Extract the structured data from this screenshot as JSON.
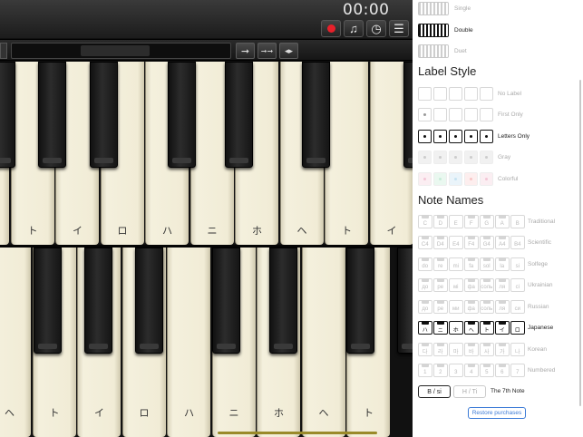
{
  "toolbar": {
    "timer": "00:00",
    "record_icon": "record-icon",
    "music_icon": "music-note-icon",
    "metronome_icon": "metronome-icon",
    "menu_icon": "menu-icon",
    "menu_glyph": "☰",
    "music_glyph": "♫",
    "metronome_glyph": "◷"
  },
  "nav": {
    "shift_one_glyph": "➞",
    "shift_octave_glyph": "➞➞",
    "split_glyph": "◂▸"
  },
  "keyboard_upper": {
    "white_labels": [
      "",
      "ト",
      "イ",
      "ロ",
      "ハ",
      "ニ",
      "ホ",
      "ヘ",
      "ト",
      "イ"
    ]
  },
  "keyboard_lower": {
    "white_labels": [
      "ヘ",
      "ト",
      "イ",
      "ロ",
      "ハ",
      "ニ",
      "ホ",
      "ヘ",
      "ト"
    ]
  },
  "panel": {
    "keyboard_layouts": [
      {
        "label": "Single",
        "active": false
      },
      {
        "label": "Double",
        "active": true
      },
      {
        "label": "Duet",
        "active": false
      }
    ],
    "label_style_title": "Label Style",
    "label_styles": [
      {
        "label": "No Label",
        "active": false
      },
      {
        "label": "First Only",
        "active": false
      },
      {
        "label": "Letters Only",
        "active": true
      },
      {
        "label": "Gray",
        "active": false
      },
      {
        "label": "Colorful",
        "active": false
      }
    ],
    "note_names_title": "Note Names",
    "note_names": [
      {
        "label": "Traditional",
        "cells": [
          "C",
          "D",
          "E",
          "F",
          "G",
          "A",
          "B"
        ],
        "active": false
      },
      {
        "label": "Scientific",
        "cells": [
          "C4",
          "D4",
          "E4",
          "F4",
          "G4",
          "A4",
          "B4"
        ],
        "active": false
      },
      {
        "label": "Solfege",
        "cells": [
          "do",
          "re",
          "mi",
          "fa",
          "sol",
          "la",
          "si"
        ],
        "active": false
      },
      {
        "label": "Ukrainian",
        "cells": [
          "до",
          "ре",
          "мі",
          "фа",
          "соль",
          "ля",
          "сі"
        ],
        "active": false
      },
      {
        "label": "Russian",
        "cells": [
          "до",
          "ре",
          "ми",
          "фа",
          "соль",
          "ля",
          "си"
        ],
        "active": false
      },
      {
        "label": "Japanese",
        "cells": [
          "ハ",
          "ニ",
          "ホ",
          "ヘ",
          "ト",
          "イ",
          "ロ"
        ],
        "active": true
      },
      {
        "label": "Korean",
        "cells": [
          "다",
          "라",
          "마",
          "바",
          "사",
          "가",
          "나"
        ],
        "active": false
      },
      {
        "label": "Numbered",
        "cells": [
          "1",
          "2",
          "3",
          "4",
          "5",
          "6",
          "7"
        ],
        "active": false
      }
    ],
    "seventh_note": {
      "option_b": "B / si",
      "option_h": "H / Ti",
      "label": "The 7th Note"
    },
    "restore_label": "Restore purchases"
  },
  "colors": {
    "record": "#e8202a",
    "accent_blue": "#3b7ad6",
    "gray_dot": "#cccccc",
    "colorful_dots": [
      "#f3c6d6",
      "#c9ecd9",
      "#c7e3f2",
      "#f7c6c6",
      "#f3c6d6"
    ]
  }
}
